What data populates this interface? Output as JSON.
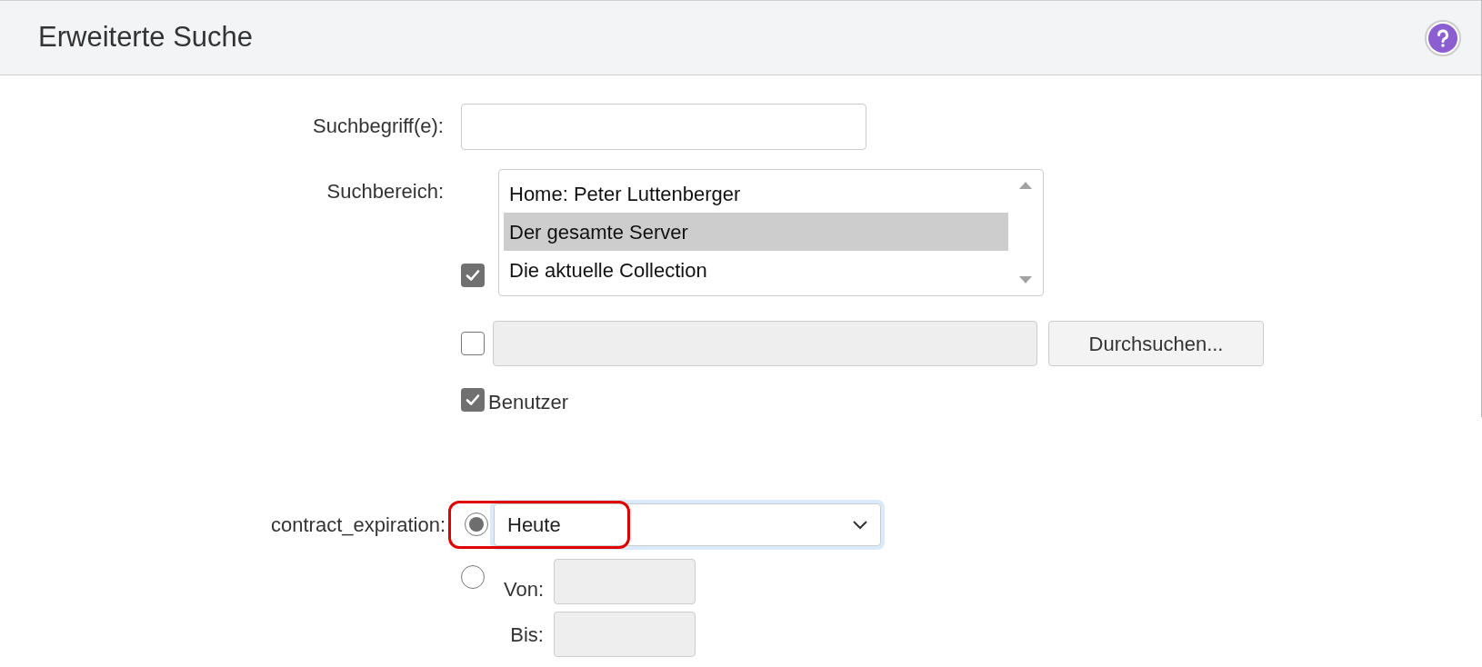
{
  "dialog": {
    "title": "Erweiterte Suche"
  },
  "search_term": {
    "label": "Suchbegriff(e):"
  },
  "search_scope": {
    "label": "Suchbereich:",
    "options": [
      {
        "text": "Home: Peter Luttenberger",
        "selected": false
      },
      {
        "text": "Der gesamte Server",
        "selected": true
      },
      {
        "text": "Die aktuelle Collection",
        "selected": false
      }
    ],
    "checked": true
  },
  "path": {
    "checked": false,
    "button": "Durchsuchen..."
  },
  "user": {
    "label": "Benutzer",
    "checked": true
  },
  "contract_expiration": {
    "label": "contract_expiration:",
    "highlighted": true,
    "modes": [
      {
        "kind": "preset",
        "selected": true,
        "value": "Heute"
      },
      {
        "kind": "range",
        "selected": false,
        "from_label": "Von:",
        "to_label": "Bis:"
      }
    ]
  }
}
